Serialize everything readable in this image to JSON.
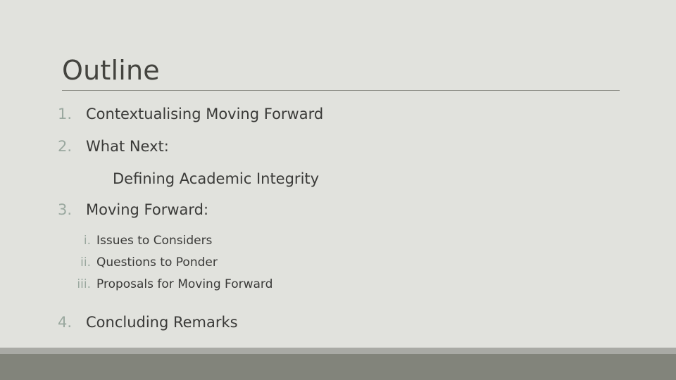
{
  "slide": {
    "title": "Outline",
    "colors": {
      "background": "#e1e2dd",
      "text": "#3a3a38",
      "title_text": "#44443f",
      "marker": "#9aa89f",
      "rule": "#8c8d86",
      "band_thin": "#a9aaa5",
      "band_footer": "#82847b"
    },
    "outline": {
      "items": [
        {
          "marker": "1.",
          "label": "Contextualising Moving Forward"
        },
        {
          "marker": "2.",
          "label": "What Next:"
        },
        {
          "marker": "",
          "label": "Defining Academic Integrity"
        },
        {
          "marker": "3.",
          "label": "Moving Forward:"
        },
        {
          "marker": "4.",
          "label": "Concluding Remarks"
        }
      ],
      "sub_items": [
        {
          "marker": "i.",
          "label": "Issues to Considers"
        },
        {
          "marker": "ii.",
          "label": "Questions to Ponder"
        },
        {
          "marker": "iii.",
          "label": "Proposals for Moving Forward"
        }
      ]
    }
  }
}
